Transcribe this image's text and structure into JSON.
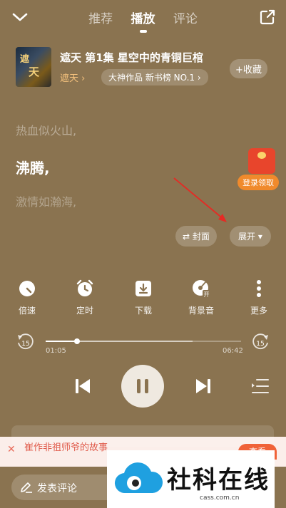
{
  "tabs": [
    {
      "label": "推荐"
    },
    {
      "label": "播放"
    },
    {
      "label": "评论"
    }
  ],
  "book": {
    "cover_text_a": "遮",
    "cover_text_b": "天",
    "title": "遮天 第1集 星空中的青铜巨棺",
    "author": "遮天 ›",
    "badge": "大神作品 新书榜 NO.1 ›",
    "favorite": "+收藏"
  },
  "lyrics": {
    "prev": "热血似火山,",
    "current": "沸腾,",
    "next": "激情如瀚海,"
  },
  "promo": {
    "login": "登录领取"
  },
  "actions": {
    "cover": "封面",
    "expand": "展开 ▾"
  },
  "tools": [
    {
      "label": "倍速",
      "icon": "speed-icon"
    },
    {
      "label": "定时",
      "icon": "alarm-icon"
    },
    {
      "label": "下载",
      "icon": "download-icon"
    },
    {
      "label": "背景音",
      "icon": "background-music-icon"
    },
    {
      "label": "更多",
      "icon": "more-icon"
    }
  ],
  "progress": {
    "current": "01:05",
    "total": "06:42",
    "fraction": 0.162,
    "buffered": 0.75,
    "back": "15",
    "forward": "15"
  },
  "banner": {
    "text": "崔作非祖师爷的故事",
    "button": "查看"
  },
  "bottom": {
    "comment": "发表评论"
  },
  "watermark": {
    "name": "社科在线",
    "url": "cass.com.cn"
  }
}
